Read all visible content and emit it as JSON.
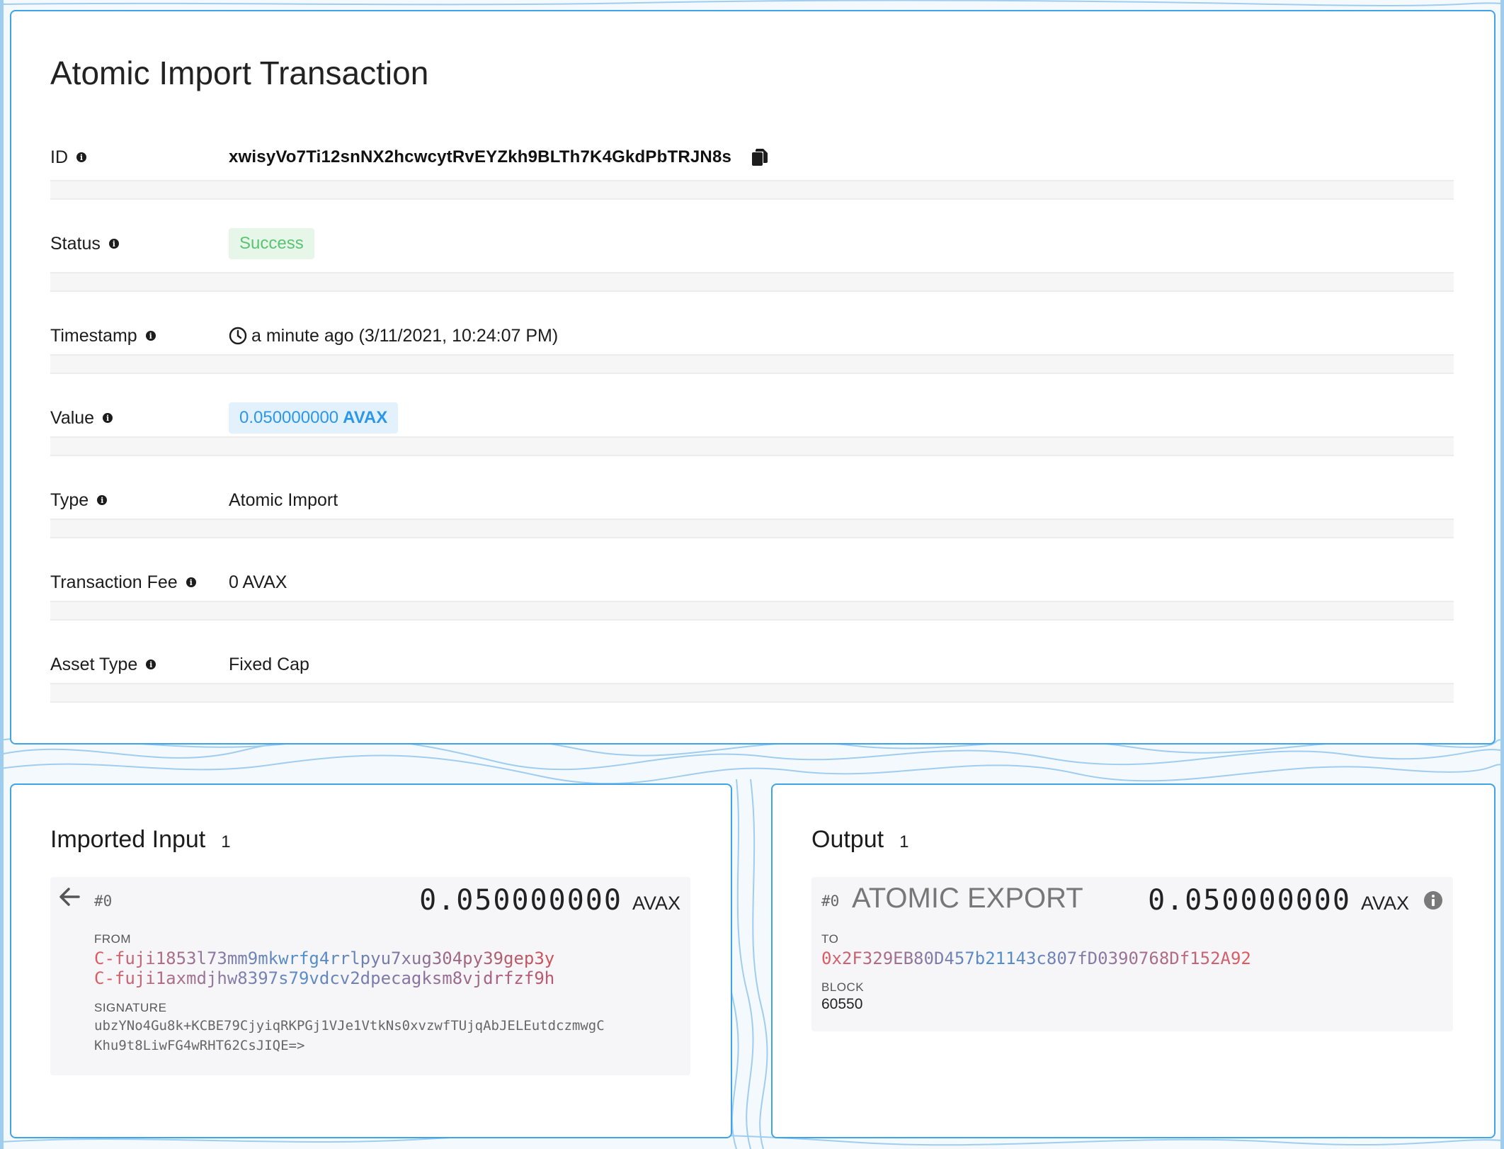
{
  "page_title": "Atomic Import Transaction",
  "details": [
    {
      "label": "ID",
      "value": "xwisyVo7Ti12snNX2hcwcytRvEYZkh9BLTh7K4GkdPbTRJN8s"
    },
    {
      "label": "Status",
      "value": "Success"
    },
    {
      "label": "Timestamp",
      "value": "a minute ago (3/11/2021, 10:24:07 PM)"
    },
    {
      "label": "Value",
      "value": "0.050000000",
      "unit": "AVAX"
    },
    {
      "label": "Type",
      "value": "Atomic Import"
    },
    {
      "label": "Transaction Fee",
      "value": "0 AVAX"
    },
    {
      "label": "Asset Type",
      "value": "Fixed Cap"
    }
  ],
  "imported_input": {
    "title": "Imported Input",
    "count": "1",
    "item": {
      "index": "#0",
      "amount": "0.050000000",
      "unit": "AVAX",
      "from_label": "FROM",
      "from_addresses": [
        "C-fuji1853l73mm9mkwrfg4rrlpyu7xug304py39gep3y",
        "C-fuji1axmdjhw8397s79vdcv2dpecagksm8vjdrfzf9h"
      ],
      "signature_label": "SIGNATURE",
      "signature_lines": [
        "ubzYNo4Gu8k+KCBE79CjyiqRKPGj1VJe1VtkNs0xvzwfTUjqAbJELEutdczmwgC",
        "Khu9t8LiwFG4wRHT62CsJIQE=>"
      ]
    }
  },
  "output": {
    "title": "Output",
    "count": "1",
    "item": {
      "index": "#0",
      "type": "ATOMIC EXPORT",
      "amount": "0.050000000",
      "unit": "AVAX",
      "to_label": "TO",
      "to_address": "0x2F329EB80D457b21143c807fD0390768Df152A92",
      "block_label": "BLOCK",
      "block": "60550"
    }
  },
  "colors": {
    "card_border": "#3fa3e8",
    "success_bg": "#e6f7e9",
    "success_text": "#5cc373",
    "value_bg": "#e3f1fc",
    "value_text": "#2b97ea",
    "address_gradient": [
      "#e0595f",
      "#3d8fd6",
      "#e0595f"
    ]
  }
}
